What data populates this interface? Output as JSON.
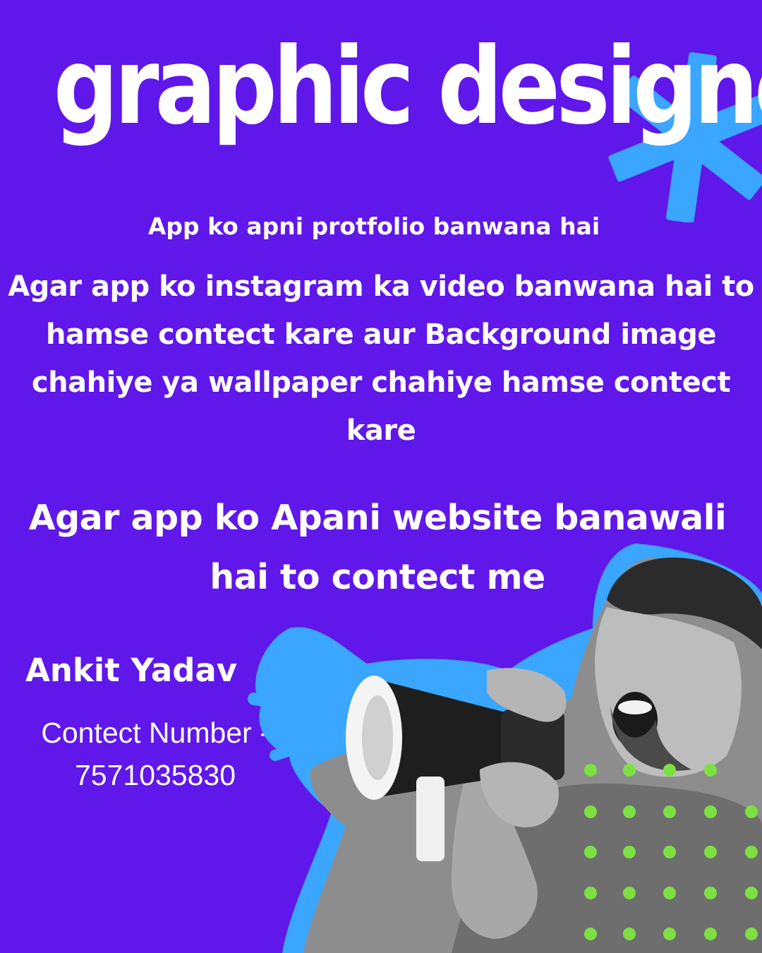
{
  "title": "graphic designer",
  "line1": "App ko apni  protfolio banwana hai",
  "paragraph1": "Agar app ko instagram ka video banwana hai to hamse contect kare aur Background image chahiye ya wallpaper chahiye hamse contect kare",
  "paragraph2": "Agar app ko Apani website banawali hai to contect me",
  "name": "Ankit Yadav",
  "contact": {
    "label": "Contect Number -",
    "number": "7571035830"
  },
  "colors": {
    "background": "#5f17ea",
    "accent_blue": "#3aa6ff",
    "accent_green": "#7de042",
    "text": "#ffffff"
  },
  "icons": {
    "starburst": "starburst-icon",
    "megaphone": "megaphone-icon"
  }
}
